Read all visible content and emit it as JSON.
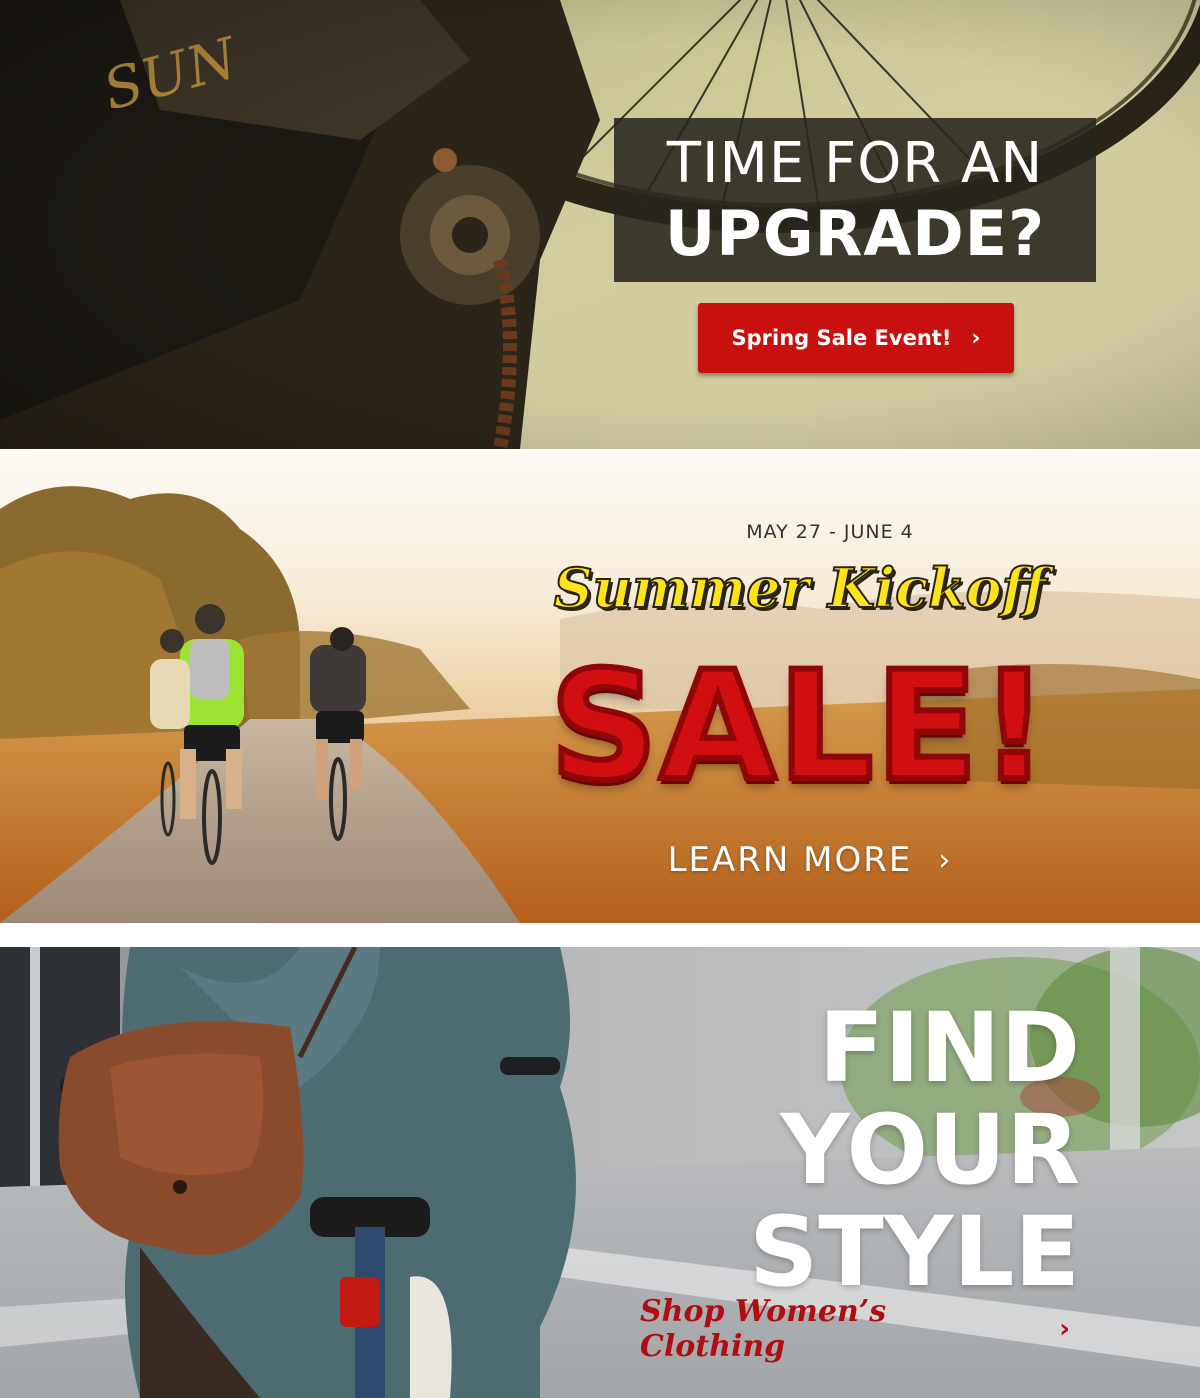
{
  "banner1": {
    "headline_line1": "TIME FOR AN",
    "headline_line2": "UPGRADE?",
    "cta_label": "Spring Sale Event!",
    "cta_chevron": "›",
    "cta_color": "#c8110f"
  },
  "banner2": {
    "date_range": "MAY 27 - JUNE 4",
    "subtitle": "Summer Kickoff",
    "headline": "SALE!",
    "cta_label": "LEARN MORE",
    "cta_chevron": "›",
    "headline_color": "#d10f10",
    "subtitle_color": "#ffe31a"
  },
  "banner3": {
    "headline_line1": "FIND",
    "headline_line2": "YOUR",
    "headline_line3": "STYLE",
    "cta_label": "Shop Women’s Clothing",
    "cta_chevron": "›",
    "cta_color": "#b00d12"
  },
  "icons": [
    "chevron-right-icon"
  ]
}
